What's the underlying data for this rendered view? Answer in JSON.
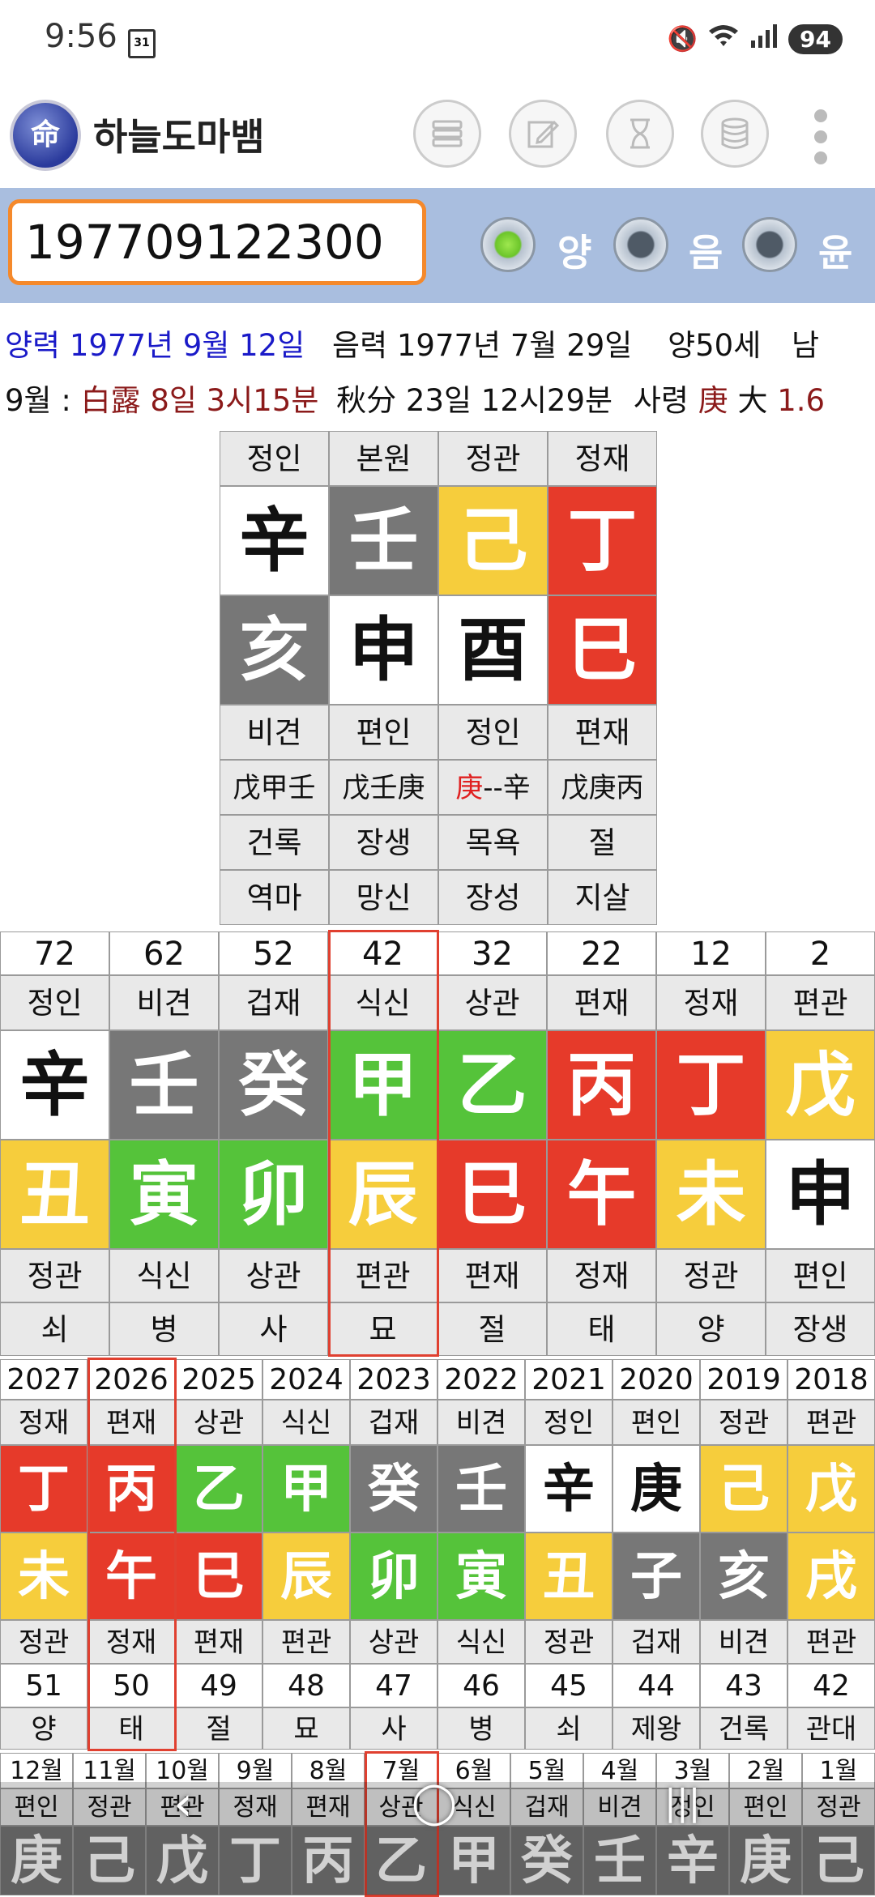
{
  "status": {
    "time": "9:56",
    "calendar_day": "31",
    "battery": "94"
  },
  "app": {
    "title": "하늘도마뱀",
    "logo_char": "命"
  },
  "toolbar": {
    "icons": [
      "list-icon",
      "edit-icon",
      "hourglass-icon",
      "database-icon",
      "more-vert-icon"
    ]
  },
  "input": {
    "value": "197709122300"
  },
  "modes": [
    {
      "label": "양",
      "selected": true
    },
    {
      "label": "음",
      "selected": false
    },
    {
      "label": "윤",
      "selected": false
    }
  ],
  "info": {
    "solar": "양력 1977년 9월 12일",
    "lunar": "음력 1977년 7월 29일",
    "age": "양50세",
    "gender": "남",
    "month_prefix": "9월 :",
    "term1": "白露 8일 3시15분",
    "term2": "秋分 23일 12시29분",
    "saryeong_label": "사령",
    "saryeong_char": "庚",
    "saryeong_size": "大",
    "saryeong_value": "1.6"
  },
  "pillars": {
    "top_labels": [
      "정인",
      "본원",
      "정관",
      "정재"
    ],
    "stems": [
      {
        "c": "辛",
        "col": "white"
      },
      {
        "c": "壬",
        "col": "gray"
      },
      {
        "c": "己",
        "col": "yellow"
      },
      {
        "c": "丁",
        "col": "red"
      }
    ],
    "branches": [
      {
        "c": "亥",
        "col": "gray"
      },
      {
        "c": "申",
        "col": "white"
      },
      {
        "c": "酉",
        "col": "white"
      },
      {
        "c": "巳",
        "col": "red"
      }
    ],
    "branch_labels": [
      "비견",
      "편인",
      "정인",
      "편재"
    ],
    "hidden": [
      "戊甲壬",
      "戊壬庚",
      "--辛",
      "戊庚丙"
    ],
    "hidden_highlight": "庚",
    "stages": [
      "건록",
      "장생",
      "목욕",
      "절"
    ],
    "spirits": [
      "역마",
      "망신",
      "장성",
      "지살"
    ]
  },
  "daeun": {
    "ages": [
      "72",
      "62",
      "52",
      "42",
      "32",
      "22",
      "12",
      "2"
    ],
    "stem_labels": [
      "정인",
      "비견",
      "겁재",
      "식신",
      "상관",
      "편재",
      "정재",
      "편관"
    ],
    "stems": [
      {
        "c": "辛",
        "col": "white"
      },
      {
        "c": "壬",
        "col": "gray"
      },
      {
        "c": "癸",
        "col": "gray"
      },
      {
        "c": "甲",
        "col": "green"
      },
      {
        "c": "乙",
        "col": "green"
      },
      {
        "c": "丙",
        "col": "red"
      },
      {
        "c": "丁",
        "col": "red"
      },
      {
        "c": "戊",
        "col": "yellow"
      }
    ],
    "branches": [
      {
        "c": "丑",
        "col": "yellow"
      },
      {
        "c": "寅",
        "col": "green"
      },
      {
        "c": "卯",
        "col": "green"
      },
      {
        "c": "辰",
        "col": "yellow"
      },
      {
        "c": "巳",
        "col": "red"
      },
      {
        "c": "午",
        "col": "red"
      },
      {
        "c": "未",
        "col": "yellow"
      },
      {
        "c": "申",
        "col": "white"
      }
    ],
    "branch_labels": [
      "정관",
      "식신",
      "상관",
      "편관",
      "편재",
      "정재",
      "정관",
      "편인"
    ],
    "stages": [
      "쇠",
      "병",
      "사",
      "묘",
      "절",
      "태",
      "양",
      "장생"
    ],
    "highlight_index": 3
  },
  "seun": {
    "years": [
      "2027",
      "2026",
      "2025",
      "2024",
      "2023",
      "2022",
      "2021",
      "2020",
      "2019",
      "2018"
    ],
    "stem_labels": [
      "정재",
      "편재",
      "상관",
      "식신",
      "겁재",
      "비견",
      "정인",
      "편인",
      "정관",
      "편관"
    ],
    "stems": [
      {
        "c": "丁",
        "col": "red"
      },
      {
        "c": "丙",
        "col": "red"
      },
      {
        "c": "乙",
        "col": "green"
      },
      {
        "c": "甲",
        "col": "green"
      },
      {
        "c": "癸",
        "col": "gray"
      },
      {
        "c": "壬",
        "col": "gray"
      },
      {
        "c": "辛",
        "col": "white"
      },
      {
        "c": "庚",
        "col": "white"
      },
      {
        "c": "己",
        "col": "yellow"
      },
      {
        "c": "戊",
        "col": "yellow"
      }
    ],
    "branches": [
      {
        "c": "未",
        "col": "yellow"
      },
      {
        "c": "午",
        "col": "red"
      },
      {
        "c": "巳",
        "col": "red"
      },
      {
        "c": "辰",
        "col": "yellow"
      },
      {
        "c": "卯",
        "col": "green"
      },
      {
        "c": "寅",
        "col": "green"
      },
      {
        "c": "丑",
        "col": "yellow"
      },
      {
        "c": "子",
        "col": "gray"
      },
      {
        "c": "亥",
        "col": "gray"
      },
      {
        "c": "戌",
        "col": "yellow"
      }
    ],
    "branch_labels": [
      "정관",
      "정재",
      "편재",
      "편관",
      "상관",
      "식신",
      "정관",
      "겁재",
      "비견",
      "편관"
    ],
    "ages": [
      "51",
      "50",
      "49",
      "48",
      "47",
      "46",
      "45",
      "44",
      "43",
      "42"
    ],
    "stages": [
      "양",
      "태",
      "절",
      "묘",
      "사",
      "병",
      "쇠",
      "제왕",
      "건록",
      "관대"
    ],
    "highlight_index": 1
  },
  "wolun": {
    "months": [
      "12월",
      "11월",
      "10월",
      "9월",
      "8월",
      "7월",
      "6월",
      "5월",
      "4월",
      "3월",
      "2월",
      "1월"
    ],
    "stem_labels": [
      "편인",
      "정관",
      "편관",
      "정재",
      "편재",
      "상관",
      "식신",
      "겁재",
      "비견",
      "정인",
      "편인",
      "정관"
    ],
    "stems": [
      "庚",
      "己",
      "戊",
      "丁",
      "丙",
      "乙",
      "甲",
      "癸",
      "壬",
      "辛",
      "庚",
      "己"
    ],
    "highlight_index": 5
  },
  "nav": {
    "back": "‹",
    "home": "◯",
    "recents": "|||"
  }
}
